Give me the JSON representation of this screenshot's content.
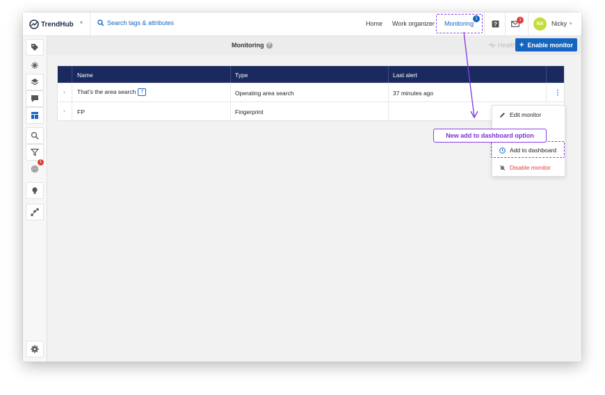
{
  "app": {
    "logo_text": "TrendHub"
  },
  "search": {
    "label": "Search tags & attributes"
  },
  "nav": {
    "home": "Home",
    "work_organizer": "Work organizer",
    "monitoring": "Monitoring",
    "monitoring_badge": "1"
  },
  "header": {
    "notifications_badge": "1",
    "avatar_initials": "NA",
    "user_name": "Nicky"
  },
  "sidebar": {
    "badge": "1"
  },
  "page": {
    "title": "Monitoring",
    "help_glyph": "?",
    "health_check": "Health check",
    "enable_monitor": "Enable monitor",
    "enable_plus": "+"
  },
  "table": {
    "columns": [
      "Name",
      "Type",
      "Last alert"
    ],
    "rows": [
      {
        "name": "That's the area search",
        "tag_count": "7",
        "type": "Operating area search",
        "last_alert": "37 minutes ago"
      },
      {
        "name": "FP",
        "tag_count": "",
        "type": "Fingerprint",
        "last_alert": ""
      }
    ]
  },
  "menu": {
    "edit": "Edit monitor",
    "add_dashboard": "Add to dashboard",
    "disable": "Disable monitor"
  },
  "annotation": {
    "callout": "New add to dashboard option"
  },
  "colors": {
    "primary": "#1565c0",
    "header_dark": "#1a2a5e",
    "danger": "#e53935",
    "annotation": "#8a3ce6",
    "avatar": "#c6db3c"
  },
  "icons": [
    "logo-icon",
    "search-icon",
    "help-icon",
    "mail-icon",
    "tag-icon",
    "asterisk-icon",
    "layers-icon",
    "chat-icon",
    "dashboard-icon",
    "magnifier-icon",
    "filter-icon",
    "fingerprint-icon",
    "bulb-icon",
    "graph-icon",
    "gear-icon",
    "pencil-icon",
    "clock-icon",
    "bell-off-icon"
  ]
}
